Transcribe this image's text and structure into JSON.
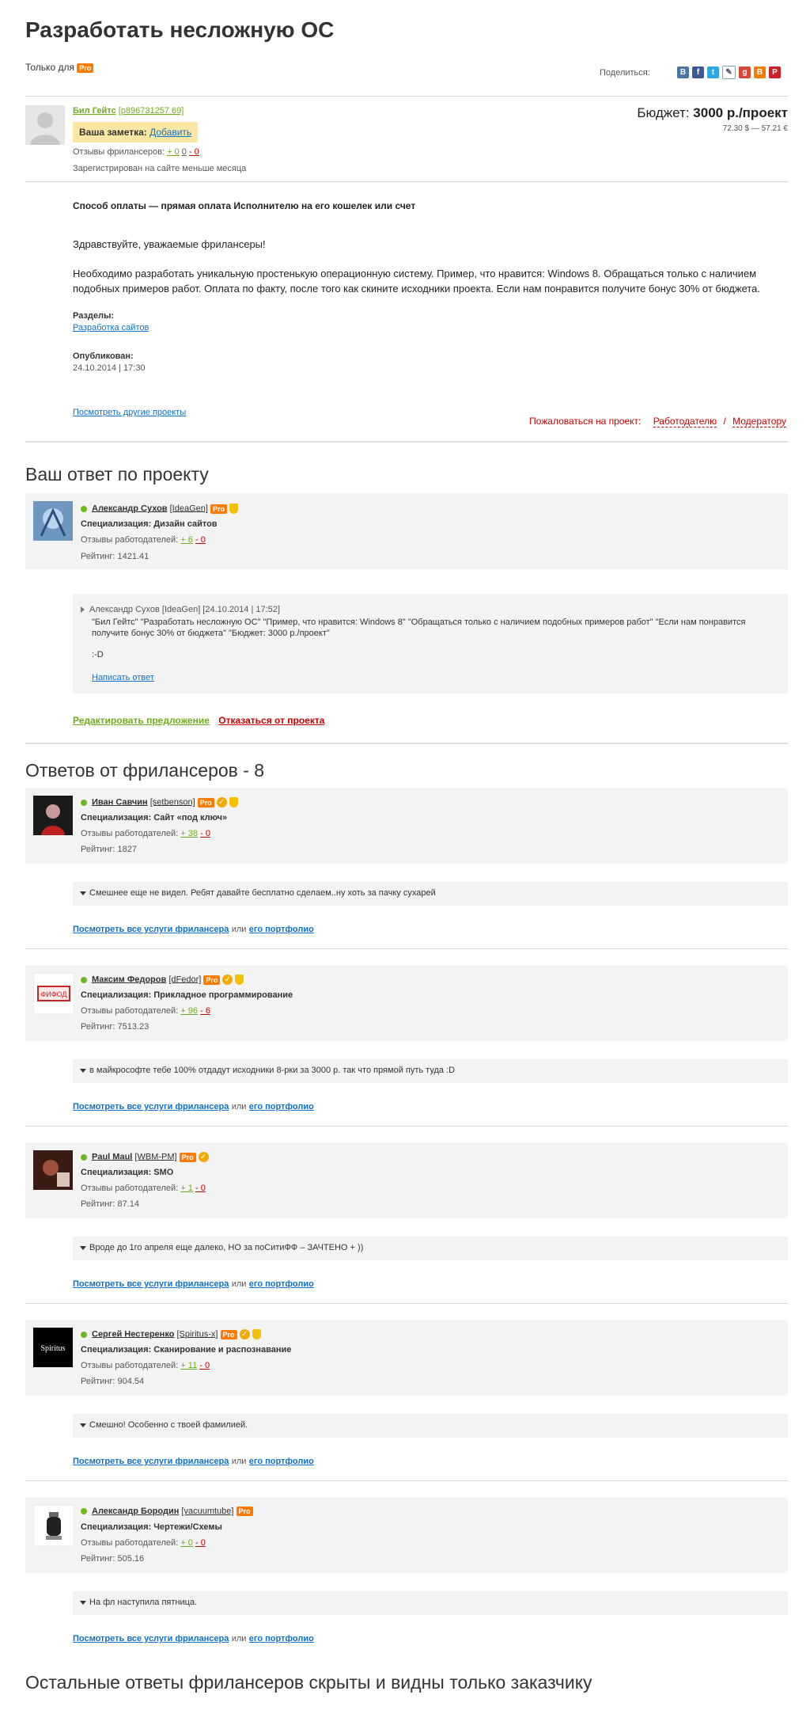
{
  "project": {
    "title": "Разработать несложную ОС",
    "only_for": "Только для",
    "pro_badge": "Pro",
    "share_label": "Поделиться:",
    "social_icons": [
      "vk-icon",
      "facebook-icon",
      "twitter-icon",
      "livejournal-icon",
      "googleplus-icon",
      "blogger-icon",
      "pinterest-icon"
    ],
    "client": {
      "name": "Бил Гейтс",
      "login": "[p896731257 69]",
      "note_label": "Ваша заметка:",
      "note_add": "Добавить",
      "reviews_label": "Отзывы фрилансеров:",
      "reviews_plus": "+ 0",
      "reviews_zero": "0",
      "reviews_minus": "- 0",
      "registered": "Зарегистрирован на сайте меньше месяца"
    },
    "budget_label": "Бюджет:",
    "budget_value": "3000 р./проект",
    "budget_conv": "72.30 $ — 57.21 €",
    "payment": "Способ оплаты — прямая оплата Исполнителю на его кошелек или счет",
    "greeting": "Здравствуйте, уважаемые фрилансеры!",
    "description": "Необходимо разработать уникальную простенькую операционную систему. Пример, что нравится: Windows 8. Обращаться только с наличием подобных примеров работ. Оплата по факту, после того как скините исходники проекта. Если нам понравится получите бонус 30% от бюджета.",
    "sections_label": "Разделы:",
    "section": "Разработка сайтов",
    "published_label": "Опубликован:",
    "published": "24.10.2014 | 17:30",
    "other_projects": "Посмотреть другие проекты",
    "complain_label": "Пожаловаться на проект:",
    "complain_employer": "Работодателю",
    "complain_sep": "/",
    "complain_moderator": "Модератору"
  },
  "my_answer": {
    "heading": "Ваш ответ по проекту",
    "name": "Александр Сухов",
    "login": "[IdeaGen]",
    "pro": "Pro",
    "spec": "Специализация: Дизайн сайтов",
    "reviews_label": "Отзывы работодателей:",
    "reviews_plus": "+ 6",
    "reviews_minus": "- 0",
    "rating": "Рейтинг: 1421.41",
    "msg_author": "Александр Сухов [IdeaGen] [24.10.2014 | 17:52]",
    "msg_text": "\"Бил Гейтс\" \"Разработать несложную ОС\" \"Пример, что нравится: Windows 8\" \"Обращаться только с наличием подобных примеров работ\" \"Если нам понравится получите бонус 30% от бюджета\" \"Бюджет:  3000 р./проект\"",
    "msg_smile": ":-D",
    "write_reply": "Написать ответ",
    "edit": "Редактировать предложение",
    "refuse": "Отказаться от проекта"
  },
  "answers_heading": "Ответов от фрилансеров - 8",
  "freelancers": [
    {
      "name": "Иван Савчин",
      "login": "[setbenson]",
      "pro": "Pro",
      "spec": "Специализация: Сайт «под ключ»",
      "reviews_label": "Отзывы работодателей:",
      "plus": "+ 38",
      "minus": "- 0",
      "rating": "Рейтинг: 1827",
      "comment": "Смешнее еще не видел. Ребят давайте бесплатно сделаем..ну хоть за пачку сухарей",
      "services": "Посмотреть все услуги фрилансера",
      "or": "или",
      "portfolio": "его портфолио"
    },
    {
      "name": "Максим Федоров",
      "login": "[dFedor]",
      "pro": "Pro",
      "spec": "Специализация: Прикладное программирование",
      "reviews_label": "Отзывы работодателей:",
      "plus": "+ 96",
      "minus": "- 6",
      "rating": "Рейтинг: 7513.23",
      "comment": "в майкрософте тебе 100% отдадут исходники 8-рки за 3000 р. так что прямой путь туда :D",
      "services": "Посмотреть все услуги фрилансера",
      "or": "или",
      "portfolio": "его портфолио"
    },
    {
      "name": "Paul Maul",
      "login": "[WBM-PM]",
      "pro": "Pro",
      "spec": "Специализация: SMO",
      "reviews_label": "Отзывы работодателей:",
      "plus": "+ 1",
      "minus": "- 0",
      "rating": "Рейтинг: 87.14",
      "comment": "Вроде до 1го апреля еще далеко, НО за поСитиФФ – ЗАЧТЕНО + ))",
      "services": "Посмотреть все услуги фрилансера",
      "or": "или",
      "portfolio": "его портфолио"
    },
    {
      "name": "Сергей Нестеренко",
      "login": "[Spiritus-x]",
      "pro": "Pro",
      "spec": "Специализация: Сканирование и распознавание",
      "reviews_label": "Отзывы работодателей:",
      "plus": "+ 11",
      "minus": "- 0",
      "rating": "Рейтинг: 904.54",
      "comment": "Смешно! Особенно с твоей фамилией.",
      "services": "Посмотреть все услуги фрилансера",
      "or": "или",
      "portfolio": "его портфолио"
    },
    {
      "name": "Александр Бородин",
      "login": "[vacuumtube]",
      "pro": "Pro",
      "spec": "Специализация: Чертежи/Схемы",
      "reviews_label": "Отзывы работодателей:",
      "plus": "+ 0",
      "minus": "- 0",
      "rating": "Рейтинг: 505.16",
      "comment": "На фл наступила пятница.",
      "services": "Посмотреть все услуги фрилансера",
      "or": "или",
      "portfolio": "его портфолио"
    }
  ],
  "hidden_heading": "Остальные ответы фрилансеров скрыты и видны только заказчику"
}
